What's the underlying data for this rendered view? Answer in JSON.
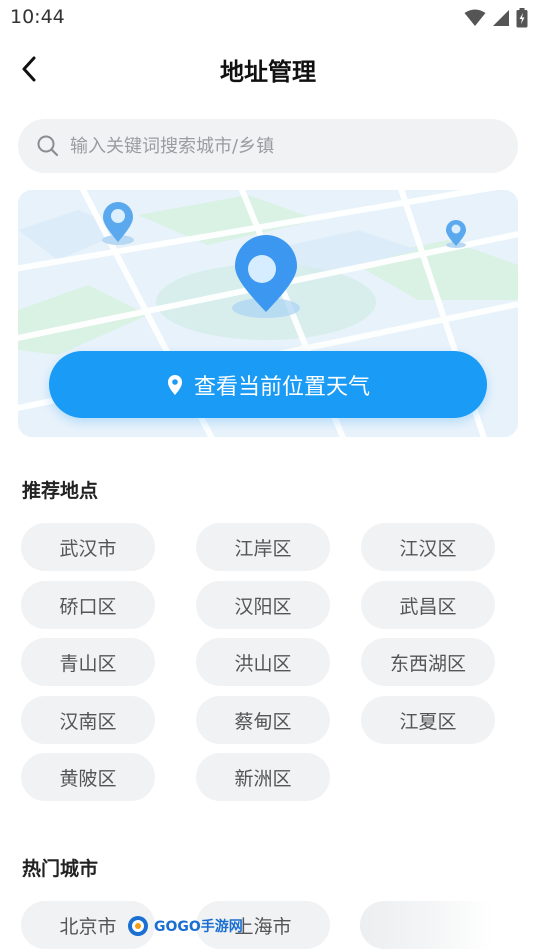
{
  "status_bar": {
    "time": "10:44"
  },
  "header": {
    "title": "地址管理"
  },
  "search": {
    "placeholder": "输入关键词搜索城市/乡镇"
  },
  "locate_button": {
    "label": "查看当前位置天气"
  },
  "recommended": {
    "title": "推荐地点",
    "items": [
      "武汉市",
      "江岸区",
      "江汉区",
      "硚口区",
      "汉阳区",
      "武昌区",
      "青山区",
      "洪山区",
      "东西湖区",
      "汉南区",
      "蔡甸区",
      "江夏区",
      "黄陂区",
      "新洲区"
    ]
  },
  "hot_cities": {
    "title": "热门城市",
    "items": [
      "北京市",
      "上海市"
    ]
  },
  "watermark": {
    "text": "GOGO手游网"
  },
  "colors": {
    "accent": "#1a9bf5",
    "chip_bg": "#f1f2f4",
    "map_bg": "#e7f1fb"
  }
}
